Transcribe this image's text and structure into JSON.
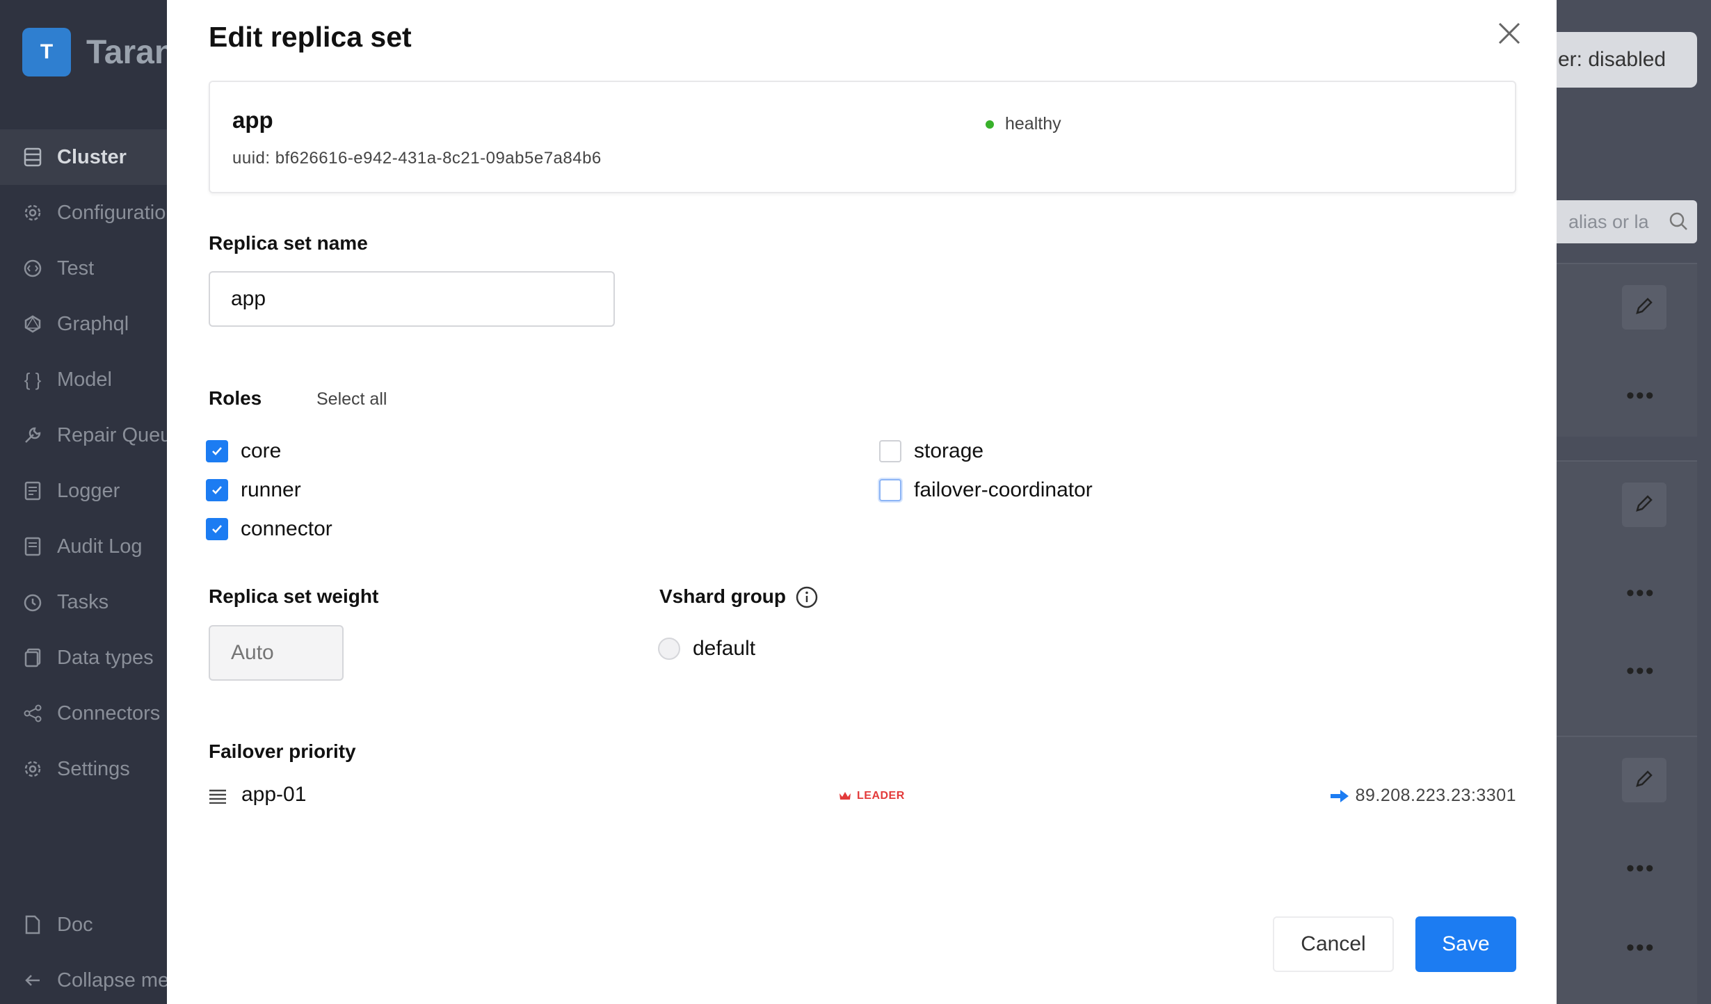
{
  "app": {
    "brand_letter": "T",
    "brand_name": "Taran",
    "sidebar": {
      "items": [
        {
          "label": "Cluster",
          "icon": "cluster-icon",
          "active": true
        },
        {
          "label": "Configuratio",
          "icon": "gear-icon"
        },
        {
          "label": "Test",
          "icon": "code-icon"
        },
        {
          "label": "Graphql",
          "icon": "graphql-icon"
        },
        {
          "label": "Model",
          "icon": "braces-icon"
        },
        {
          "label": "Repair Queu",
          "icon": "wrench-icon"
        },
        {
          "label": "Logger",
          "icon": "log-icon"
        },
        {
          "label": "Audit Log",
          "icon": "audit-icon"
        },
        {
          "label": "Tasks",
          "icon": "timer-icon"
        },
        {
          "label": "Data types",
          "icon": "datatypes-icon"
        },
        {
          "label": "Connectors",
          "icon": "share-icon"
        },
        {
          "label": "Settings",
          "icon": "settings-icon"
        }
      ],
      "bottom": [
        {
          "label": "Doc",
          "icon": "doc-icon"
        },
        {
          "label": "Collapse me",
          "icon": "arrow-left-icon"
        }
      ]
    },
    "header": {
      "failover_status": "er: disabled"
    },
    "search": {
      "placeholder": "alias or la"
    }
  },
  "modal": {
    "title": "Edit replica set",
    "replicaset": {
      "name": "app",
      "uuid": "uuid: bf626616-e942-431a-8c21-09ab5e7a84b6",
      "status": "healthy",
      "status_color": "#38b12a"
    },
    "name_field": {
      "label": "Replica set name",
      "value": "app"
    },
    "roles": {
      "label": "Roles",
      "select_all": "Select all",
      "left": [
        {
          "label": "core",
          "checked": true
        },
        {
          "label": "runner",
          "checked": true
        },
        {
          "label": "connector",
          "checked": true
        }
      ],
      "right": [
        {
          "label": "storage",
          "checked": false
        },
        {
          "label": "failover-coordinator",
          "checked": false,
          "focused": true
        }
      ]
    },
    "weight": {
      "label": "Replica set weight",
      "placeholder": "Auto"
    },
    "vshard": {
      "label": "Vshard group",
      "option": "default",
      "selected": false
    },
    "failover": {
      "label": "Failover priority",
      "servers": [
        {
          "name": "app-01",
          "badge": "LEADER",
          "address": "89.208.223.23:3301"
        }
      ]
    },
    "buttons": {
      "cancel": "Cancel",
      "save": "Save"
    },
    "colors": {
      "accent": "#1c7cf2",
      "leader": "#e33a3a"
    }
  }
}
